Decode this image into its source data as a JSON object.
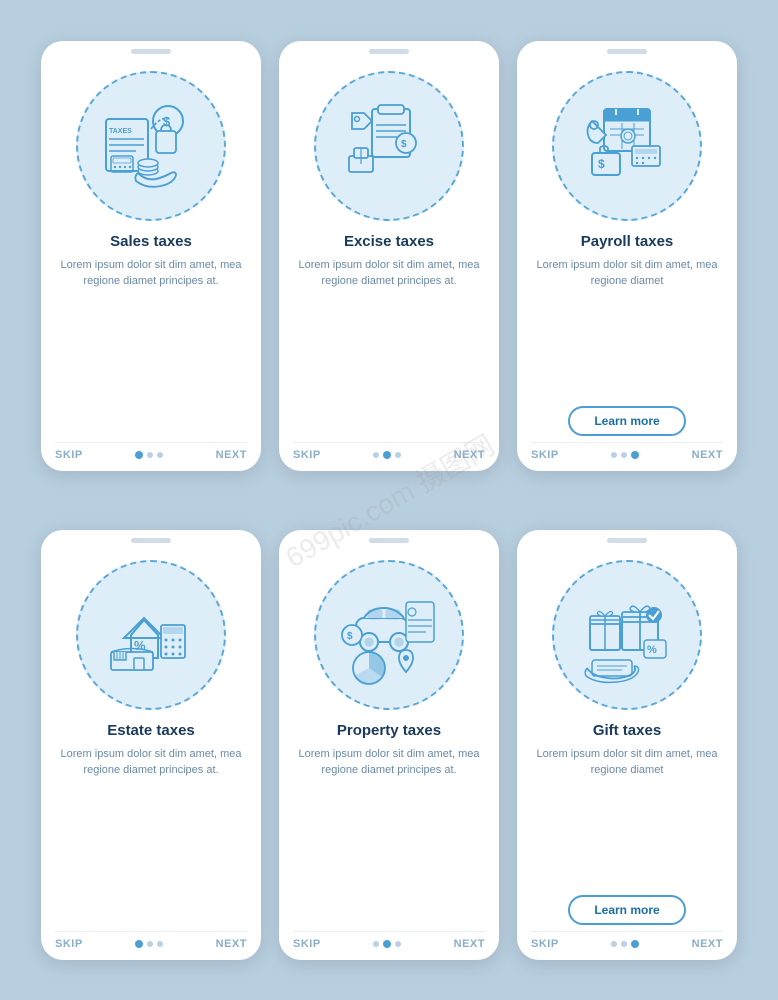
{
  "cards": [
    {
      "id": "sales-taxes",
      "title": "Sales taxes",
      "description": "Lorem ipsum dolor sit dim amet, mea regione diamet principes at.",
      "has_button": false,
      "button_label": "",
      "dots": [
        0,
        1,
        2
      ],
      "active_dot": 0
    },
    {
      "id": "excise-taxes",
      "title": "Excise taxes",
      "description": "Lorem ipsum dolor sit dim amet, mea regione diamet principes at.",
      "has_button": false,
      "button_label": "",
      "dots": [
        0,
        1,
        2
      ],
      "active_dot": 1
    },
    {
      "id": "payroll-taxes",
      "title": "Payroll taxes",
      "description": "Lorem ipsum dolor sit dim amet, mea regione diamet",
      "has_button": true,
      "button_label": "Learn more",
      "dots": [
        0,
        1,
        2
      ],
      "active_dot": 2
    },
    {
      "id": "estate-taxes",
      "title": "Estate taxes",
      "description": "Lorem ipsum dolor sit dim amet, mea regione diamet principes at.",
      "has_button": false,
      "button_label": "",
      "dots": [
        0,
        1,
        2
      ],
      "active_dot": 0
    },
    {
      "id": "property-taxes",
      "title": "Property taxes",
      "description": "Lorem ipsum dolor sit dim amet, mea regione diamet principes at.",
      "has_button": false,
      "button_label": "",
      "dots": [
        0,
        1,
        2
      ],
      "active_dot": 1
    },
    {
      "id": "gift-taxes",
      "title": "Gift taxes",
      "description": "Lorem ipsum dolor sit dim amet, mea regione diamet",
      "has_button": true,
      "button_label": "Learn more",
      "dots": [
        0,
        1,
        2
      ],
      "active_dot": 2
    }
  ],
  "footer": {
    "skip": "SKIP",
    "next": "NEXT"
  }
}
